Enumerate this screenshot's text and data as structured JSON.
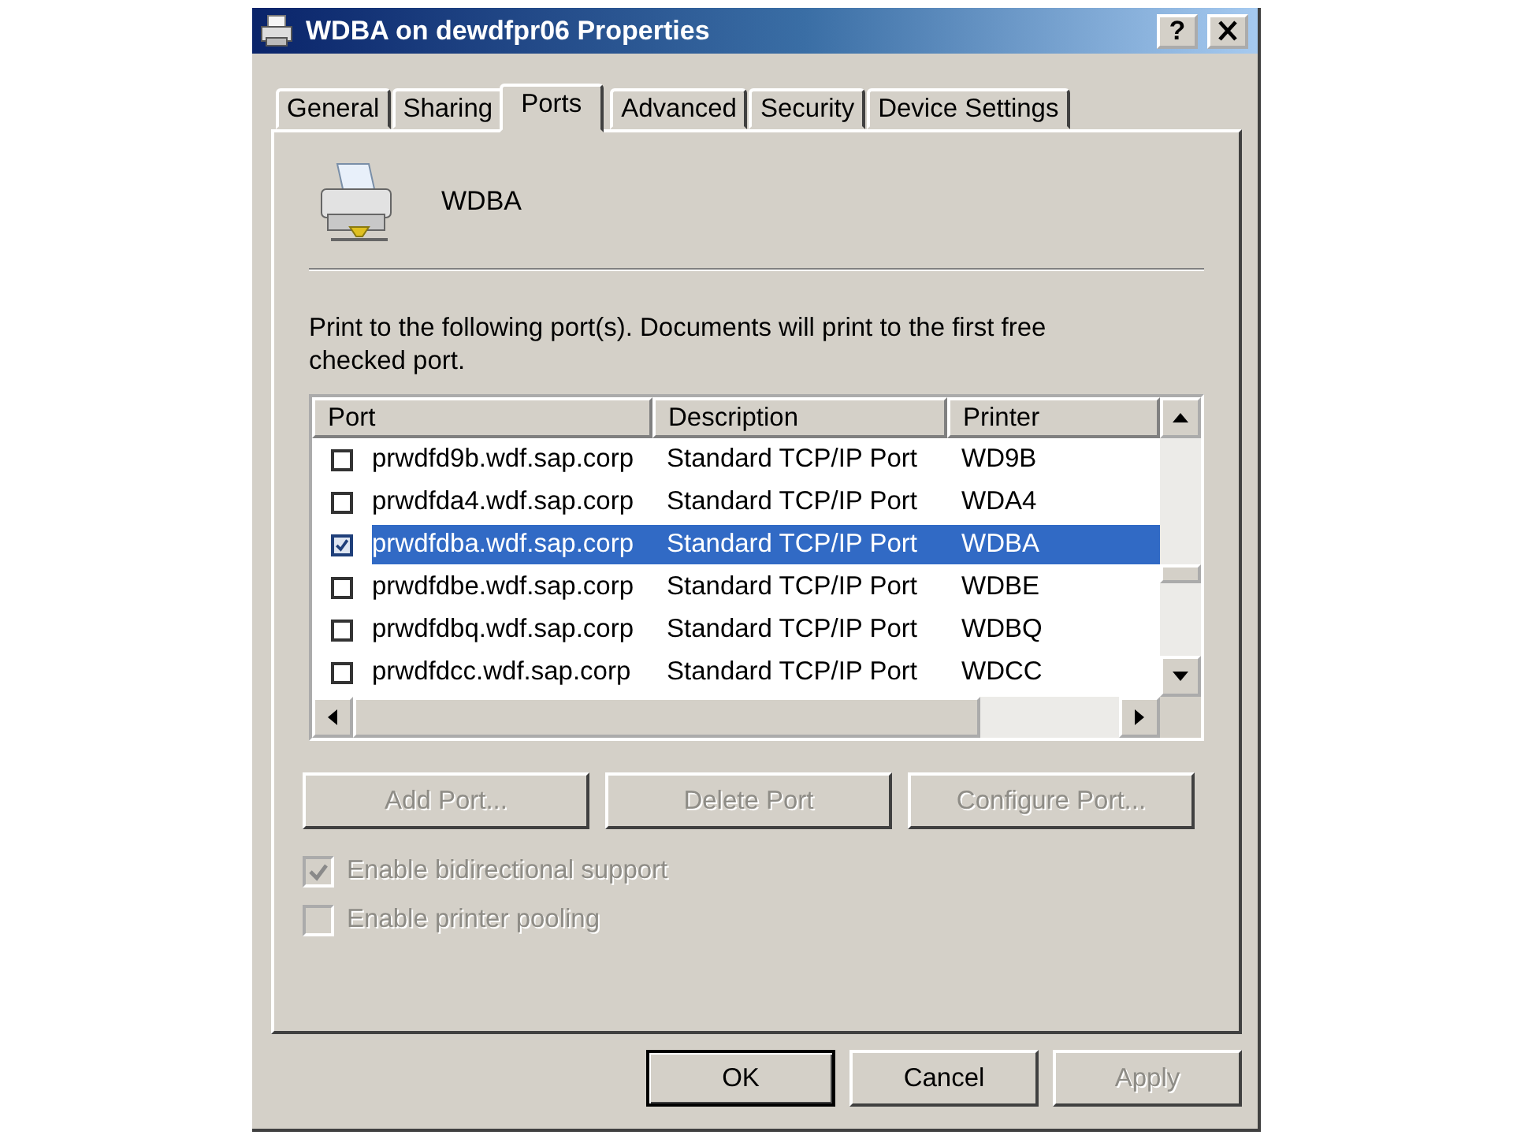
{
  "window": {
    "title": "WDBA on dewdfpr06 Properties",
    "help": "?"
  },
  "tabs": [
    {
      "label": "General",
      "selected": false
    },
    {
      "label": "Sharing",
      "selected": false
    },
    {
      "label": "Ports",
      "selected": true
    },
    {
      "label": "Advanced",
      "selected": false
    },
    {
      "label": "Security",
      "selected": false
    },
    {
      "label": "Device Settings",
      "selected": false
    }
  ],
  "printer_name": "WDBA",
  "instructions": "Print to the following port(s). Documents will print to the first free checked port.",
  "port_list": {
    "columns": [
      "Port",
      "Description",
      "Printer"
    ],
    "rows": [
      {
        "port": "prwdfd9b.wdf.sap.corp",
        "description": "Standard TCP/IP Port",
        "printer": "WD9B",
        "checked": false,
        "selected": false
      },
      {
        "port": "prwdfda4.wdf.sap.corp",
        "description": "Standard TCP/IP Port",
        "printer": "WDA4",
        "checked": false,
        "selected": false
      },
      {
        "port": "prwdfdba.wdf.sap.corp",
        "description": "Standard TCP/IP Port",
        "printer": "WDBA",
        "checked": true,
        "selected": true
      },
      {
        "port": "prwdfdbe.wdf.sap.corp",
        "description": "Standard TCP/IP Port",
        "printer": "WDBE",
        "checked": false,
        "selected": false
      },
      {
        "port": "prwdfdbq.wdf.sap.corp",
        "description": "Standard TCP/IP Port",
        "printer": "WDBQ",
        "checked": false,
        "selected": false
      },
      {
        "port": "prwdfdcc.wdf.sap.corp",
        "description": "Standard TCP/IP Port",
        "printer": "WDCC",
        "checked": false,
        "selected": false
      }
    ]
  },
  "port_buttons": [
    {
      "label": "Add Port...",
      "disabled": true
    },
    {
      "label": "Delete Port",
      "disabled": true
    },
    {
      "label": "Configure Port...",
      "disabled": true
    }
  ],
  "options": [
    {
      "label": "Enable bidirectional support",
      "checked": true,
      "disabled": true
    },
    {
      "label": "Enable printer pooling",
      "checked": false,
      "disabled": true
    }
  ],
  "dialog_buttons": [
    {
      "label": "OK",
      "disabled": false,
      "default": true
    },
    {
      "label": "Cancel",
      "disabled": false,
      "default": false
    },
    {
      "label": "Apply",
      "disabled": true,
      "default": false
    }
  ]
}
